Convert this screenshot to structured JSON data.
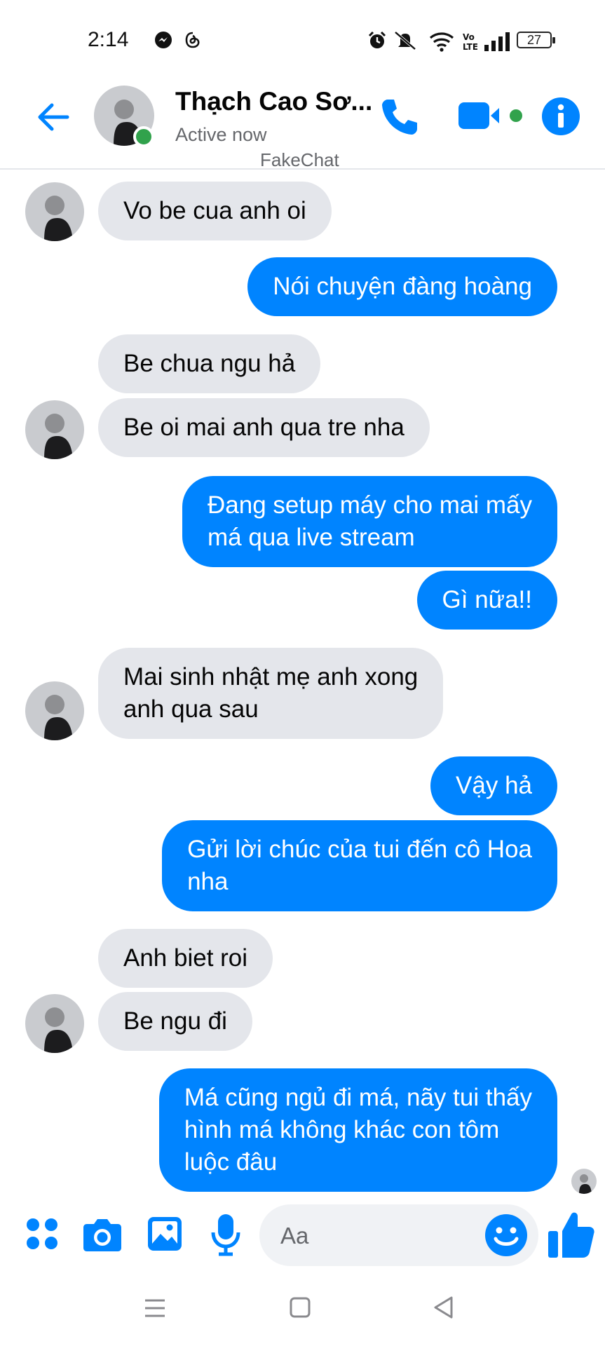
{
  "status_bar": {
    "time": "2:14",
    "battery": "27",
    "icons": [
      "messenger-icon",
      "threads-icon",
      "alarm-icon",
      "mute-icon",
      "wifi-icon",
      "volte-icon",
      "signal-icon",
      "battery-icon"
    ]
  },
  "header": {
    "contact_name": "Thạch Cao Sơ...",
    "status": "Active now",
    "watermark": "FakeChat",
    "icons": [
      "back-arrow-icon",
      "phone-icon",
      "video-camera-icon",
      "info-icon"
    ]
  },
  "messages": [
    {
      "side": "in",
      "lines": [
        "Vo be cua anh oi"
      ]
    },
    {
      "side": "out",
      "lines": [
        "Nói chuyện đàng hoàng"
      ]
    },
    {
      "side": "in",
      "lines": [
        "Be chua ngu hả"
      ]
    },
    {
      "side": "in",
      "lines": [
        "Be oi mai anh qua tre nha"
      ]
    },
    {
      "side": "out",
      "lines": [
        "Đang setup máy cho mai mấy",
        "má qua live stream"
      ]
    },
    {
      "side": "out",
      "lines": [
        "Gì nữa!!"
      ]
    },
    {
      "side": "in",
      "lines": [
        "Mai sinh nhật mẹ anh xong",
        "anh qua sau"
      ]
    },
    {
      "side": "out",
      "lines": [
        "Vậy hả"
      ]
    },
    {
      "side": "out",
      "lines": [
        "Gửi lời chúc của tui đến cô Hoa",
        "nha"
      ]
    },
    {
      "side": "in",
      "lines": [
        "Anh biet roi"
      ]
    },
    {
      "side": "in",
      "lines": [
        "Be ngu đi"
      ]
    },
    {
      "side": "out",
      "lines": [
        "Má cũng ngủ đi má, nãy tui thấy",
        "hình má không khác con tôm",
        "luộc đâu"
      ]
    }
  ],
  "composer": {
    "placeholder": "Aa",
    "icons": [
      "menu-dots-icon",
      "camera-icon",
      "gallery-icon",
      "microphone-icon",
      "emoji-icon",
      "thumbs-up-icon"
    ]
  },
  "colors": {
    "accent": "#0084ff",
    "incoming_bubble": "#e4e6eb",
    "online": "#31a24c"
  }
}
